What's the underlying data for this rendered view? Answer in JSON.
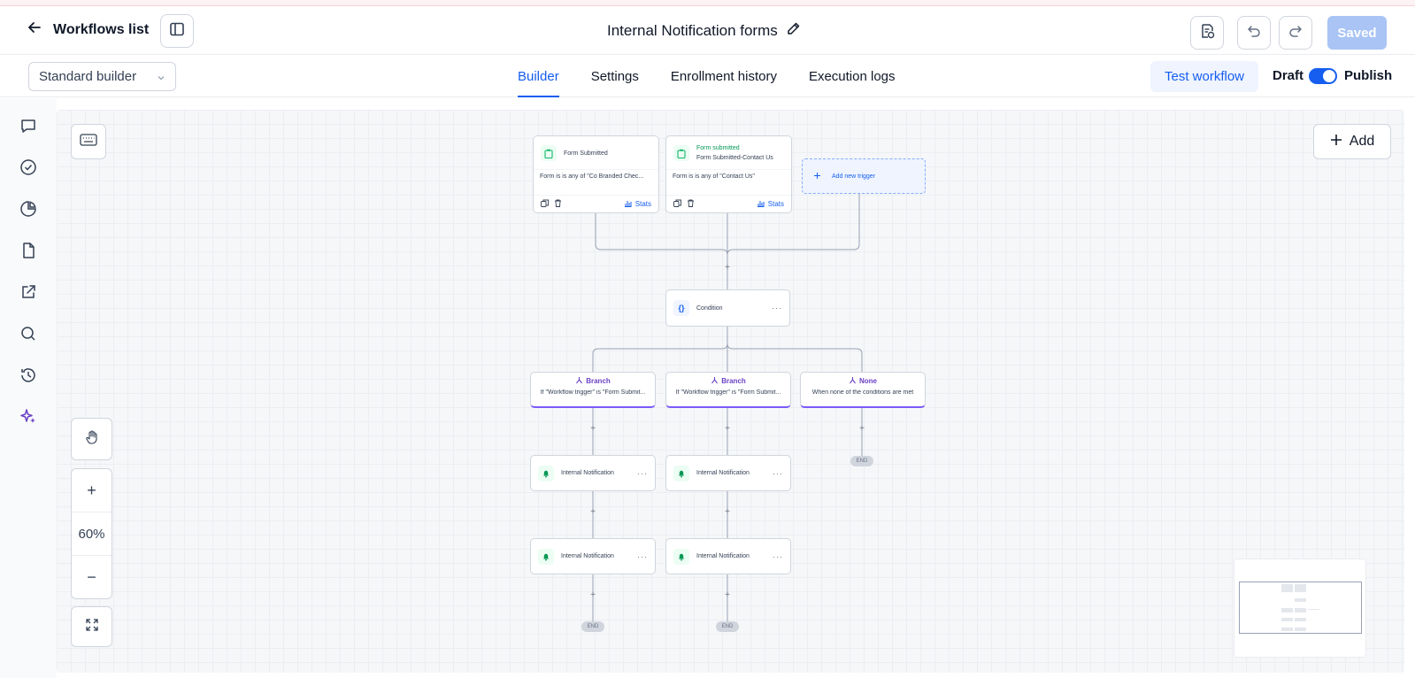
{
  "header": {
    "back_label": "Workflows list",
    "title": "Internal Notification forms",
    "saved_label": "Saved"
  },
  "subbar": {
    "builder_select": "Standard builder",
    "tabs": [
      {
        "label": "Builder",
        "active": true
      },
      {
        "label": "Settings",
        "active": false
      },
      {
        "label": "Enrollment history",
        "active": false
      },
      {
        "label": "Execution logs",
        "active": false
      }
    ],
    "test_label": "Test workflow",
    "draft_label": "Draft",
    "publish_label": "Publish"
  },
  "left_rail": {
    "icons": [
      "chat-icon",
      "check-circle-icon",
      "pie-chart-icon",
      "file-icon",
      "external-link-icon",
      "search-icon",
      "clock-history-icon",
      "sparkle-icon"
    ]
  },
  "canvas": {
    "add_label": "Add",
    "zoom_level": "60%",
    "zoom_in": "+",
    "zoom_out": "−",
    "triggers": [
      {
        "title": "Form Submitted",
        "subtitle": "",
        "desc": "Form is is any of \"Co Branded Chec...",
        "stats": "Stats"
      },
      {
        "title": "Form submitted",
        "subtitle": "Form Submitted-Contact Us",
        "desc": "Form is is any of \"Contact Us\"",
        "stats": "Stats"
      }
    ],
    "add_trigger_label": "Add new trigger",
    "condition_label": "Condition",
    "branches": [
      {
        "title": "Branch",
        "desc": "If \"Workflow trigger\" is \"Form Submit..."
      },
      {
        "title": "Branch",
        "desc": "If \"Workflow trigger\" is \"Form Submit..."
      },
      {
        "title": "None",
        "desc": "When none of the conditions are met"
      }
    ],
    "action_label": "Internal Notification",
    "end_label": "END",
    "plus_label": "+",
    "dots_label": "···"
  },
  "colors": {
    "accent": "#155eef",
    "branch": "#7a5af8",
    "saved_bg": "#a9c4f5",
    "trigger_icon": "#12b76a"
  }
}
